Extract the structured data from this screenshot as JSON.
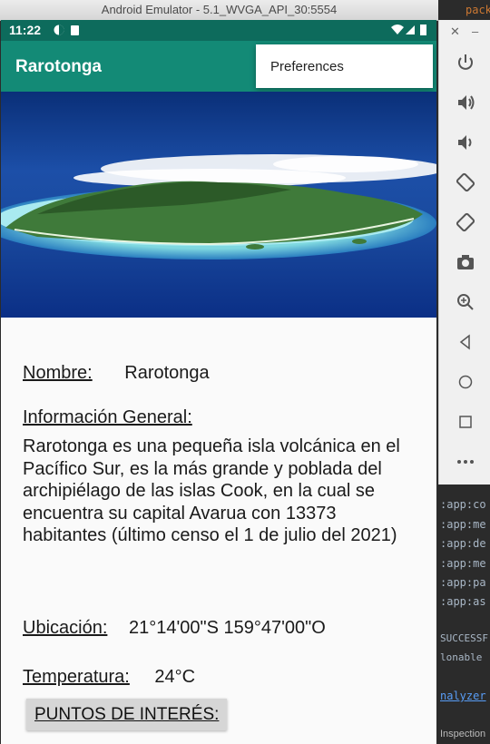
{
  "window": {
    "title": "Android Emulator - 5.1_WVGA_API_30:5554"
  },
  "status_bar": {
    "time": "11:22"
  },
  "app_bar": {
    "title": "Rarotonga"
  },
  "overflow_menu": {
    "items": [
      "Preferences"
    ]
  },
  "content": {
    "nombre_label": "Nombre:",
    "nombre_value": "Rarotonga",
    "info_label": "Información General:",
    "info_text": "Rarotonga es una pequeña isla volcánica en el Pacífico Sur, es la más grande y poblada del archipiélago de las islas Cook, en la cual se encuentra su capital Avarua con 13373 habitantes (último censo el 1 de julio del 2021)",
    "ubicacion_label": "Ubicación:",
    "ubicacion_value": "21°14'00\"S 159°47'00\"O",
    "temperatura_label": "Temperatura:",
    "temperatura_value": "24°C",
    "puntos_button": "PUNTOS DE INTERÉS:"
  },
  "ide": {
    "top_text": "pack",
    "lines": [
      ":app:co",
      ":app:me",
      ":app:de",
      ":app:me",
      ":app:pa",
      ":app:as"
    ],
    "success": "SUCCESSF",
    "lonable": "lonable",
    "analyzer": "nalyzer",
    "inspection": "Inspection"
  },
  "colors": {
    "status_bar": "#0d6b5c",
    "app_bar": "#138a76"
  },
  "emulator_toolbar": {
    "icons": [
      "close-icon",
      "minimize-icon",
      "power-icon",
      "volume-up-icon",
      "volume-down-icon",
      "rotate-left-icon",
      "rotate-right-icon",
      "camera-icon",
      "zoom-icon",
      "back-icon",
      "home-icon",
      "overview-icon",
      "more-icon"
    ]
  }
}
